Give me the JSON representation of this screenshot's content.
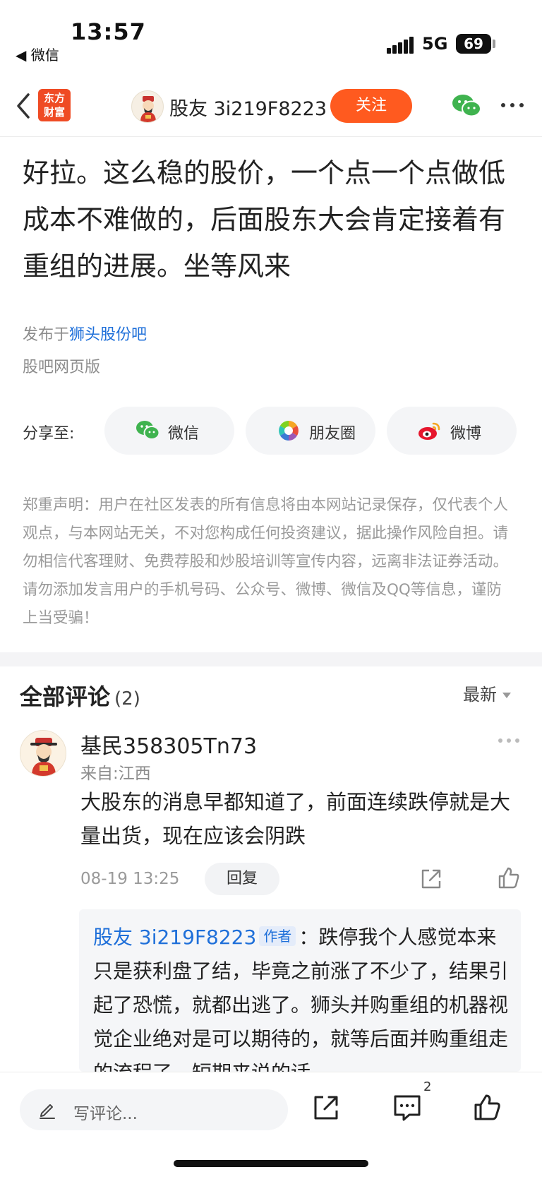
{
  "status_bar": {
    "time": "13:57",
    "back_app": "◀ 微信",
    "network": "5G",
    "battery": "69"
  },
  "nav": {
    "logo_line1": "东方",
    "logo_line2": "财富",
    "username": "股友 3i219F8223",
    "follow_label": "关注"
  },
  "post": {
    "text": "好拉。这么稳的股价，一个点一个点做低成本不难做的，后面股东大会肯定接着有重组的进展。坐等风来",
    "published_prefix": "发布于",
    "bar_name": "狮头股份吧",
    "source": "股吧网页版"
  },
  "share": {
    "label": "分享至:",
    "buttons": [
      {
        "label": "微信",
        "icon": "wechat-icon"
      },
      {
        "label": "朋友圈",
        "icon": "moments-icon"
      },
      {
        "label": "微博",
        "icon": "weibo-icon"
      }
    ]
  },
  "disclaimer": "郑重声明：用户在社区发表的所有信息将由本网站记录保存，仅代表个人观点，与本网站无关，不对您构成任何投资建议，据此操作风险自担。请勿相信代客理财、免费荐股和炒股培训等宣传内容，远离非法证券活动。请勿添加发言用户的手机号码、公众号、微博、微信及QQ等信息，谨防上当受骗！",
  "comments": {
    "title": "全部评论",
    "count": "(2)",
    "sort": "最新",
    "items": [
      {
        "name": "基民358305Tn73",
        "from": "来自:江西",
        "text": "大股东的消息早都知道了，前面连续跌停就是大量出货，现在应该会阴跌",
        "date": "08-19 13:25",
        "reply_label": "回复",
        "reply": {
          "name": "股友 3i219F8223",
          "tag": "作者",
          "separator": "：",
          "text": "跌停我个人感觉本来只是获利盘了结，毕竟之前涨了不少了，结果引起了恐慌，就都出逃了。狮头并购重组的机器视觉企业绝对是可以期待的，就等后面并购重组走的流程了，短期来说的话"
        }
      }
    ]
  },
  "bottom_bar": {
    "placeholder": "写评论...",
    "comment_count": "2"
  },
  "colors": {
    "accent_orange": "#ff5a1f",
    "link_blue": "#1e6fd9",
    "logo_red": "#ef4b24"
  }
}
